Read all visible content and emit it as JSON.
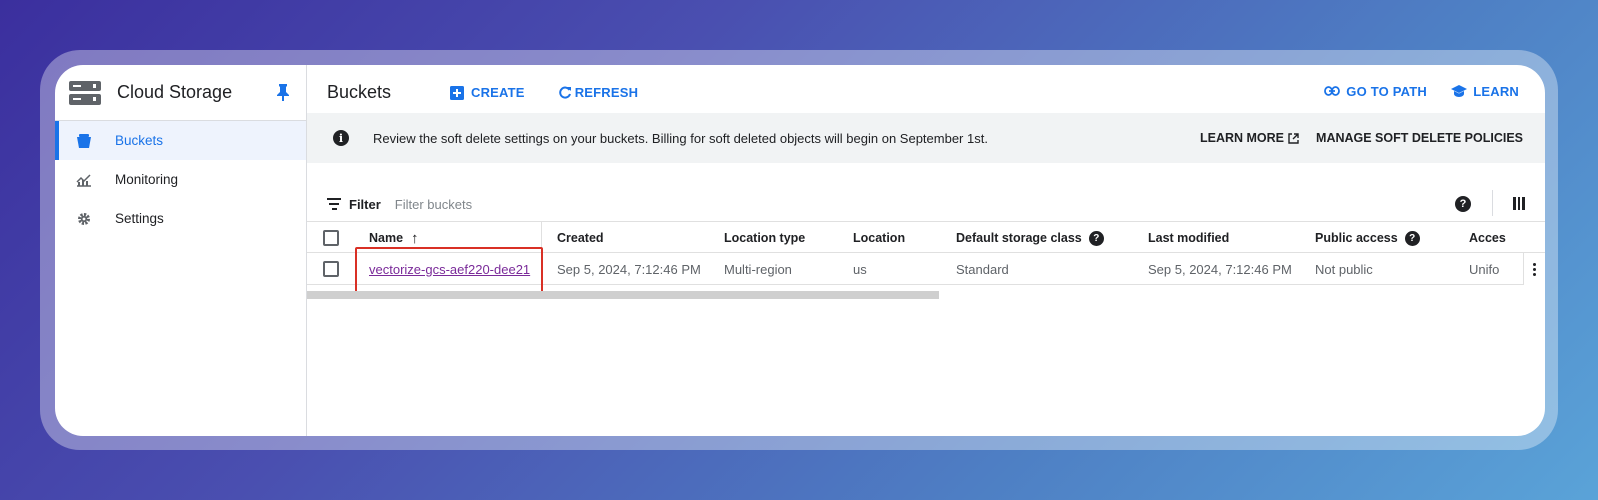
{
  "sidebar": {
    "title": "Cloud Storage",
    "items": [
      {
        "label": "Buckets",
        "icon": "bucket-icon",
        "active": true
      },
      {
        "label": "Monitoring",
        "icon": "monitoring-icon",
        "active": false
      },
      {
        "label": "Settings",
        "icon": "gear-icon",
        "active": false
      }
    ]
  },
  "toolbar": {
    "title": "Buckets",
    "create_label": "CREATE",
    "refresh_label": "REFRESH",
    "goto_label": "GO TO PATH",
    "learn_label": "LEARN"
  },
  "banner": {
    "message": "Review the soft delete settings on your buckets. Billing for soft deleted objects will begin on September 1st.",
    "learn_more": "LEARN MORE",
    "manage": "MANAGE SOFT DELETE POLICIES"
  },
  "filter": {
    "label": "Filter",
    "placeholder": "Filter buckets"
  },
  "table": {
    "columns": {
      "name": "Name",
      "created": "Created",
      "location_type": "Location type",
      "location": "Location",
      "storage_class": "Default storage class",
      "last_modified": "Last modified",
      "public_access": "Public access",
      "access": "Acces"
    },
    "rows": [
      {
        "name": "vectorize-gcs-aef220-dee21",
        "created": "Sep 5, 2024, 7:12:46 PM",
        "location_type": "Multi-region",
        "location": "us",
        "storage_class": "Standard",
        "last_modified": "Sep 5, 2024, 7:12:46 PM",
        "public_access": "Not public",
        "access": "Unifo"
      }
    ]
  },
  "colors": {
    "accent": "#1a73e8",
    "link_visited": "#7a2a99",
    "highlight": "#d93025"
  }
}
